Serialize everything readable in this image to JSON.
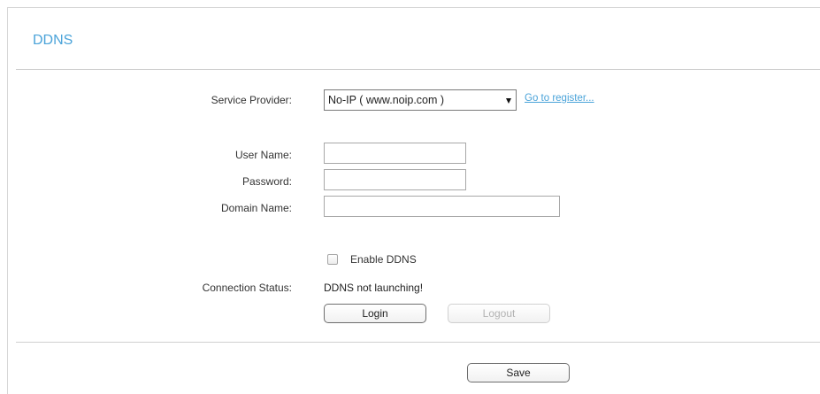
{
  "header": {
    "title": "DDNS"
  },
  "form": {
    "service_provider": {
      "label": "Service Provider:",
      "selected": "No-IP ( www.noip.com )",
      "register_link": "Go to register..."
    },
    "user_name": {
      "label": "User Name:",
      "value": ""
    },
    "password": {
      "label": "Password:",
      "value": ""
    },
    "domain_name": {
      "label": "Domain Name:",
      "value": ""
    },
    "enable_ddns": {
      "label": "Enable DDNS",
      "checked": false
    },
    "connection_status": {
      "label": "Connection Status:",
      "value": "DDNS not launching!"
    },
    "login_label": "Login",
    "logout_label": "Logout"
  },
  "footer": {
    "save_label": "Save"
  },
  "colors": {
    "accent": "#4aa3d9",
    "divider": "#d0d0d0",
    "disabled_text": "#b3b3b3"
  }
}
